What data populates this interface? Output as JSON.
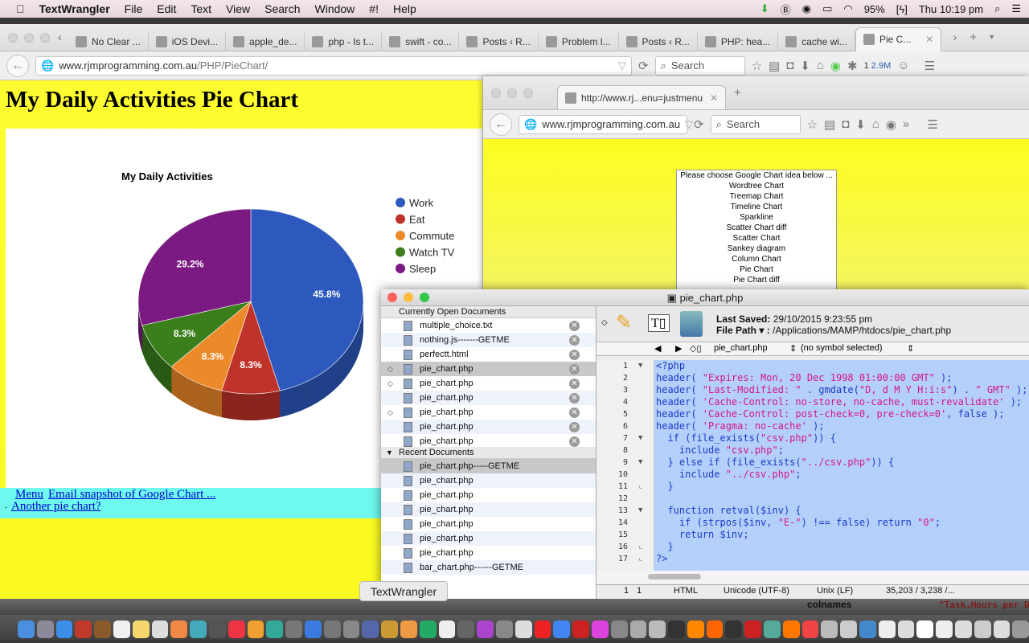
{
  "menubar": {
    "app": "TextWrangler",
    "items": [
      "File",
      "Edit",
      "Text",
      "View",
      "Search",
      "Window",
      "#!",
      "Help"
    ],
    "battery": "95%",
    "clock": "Thu 10:19 pm"
  },
  "browser1": {
    "tabs": [
      {
        "label": "No Clear ..."
      },
      {
        "label": "iOS Devi..."
      },
      {
        "label": "apple_de..."
      },
      {
        "label": "php - Is t..."
      },
      {
        "label": "swift - co..."
      },
      {
        "label": "Posts ‹ R..."
      },
      {
        "label": "Problem l..."
      },
      {
        "label": "Posts ‹ R..."
      },
      {
        "label": "PHP: hea..."
      },
      {
        "label": "cache wi..."
      },
      {
        "label": "Pie C...",
        "active": true
      }
    ],
    "url_host": "www.rjmprogramming.com.au",
    "url_path": "/PHP/PieChart/",
    "search_placeholder": "Search",
    "badge": "1",
    "badge2": "2.9M",
    "page": {
      "title": "My Daily Activities Pie Chart",
      "links": {
        "menu": "Menu",
        "email": "Email snapshot of Google Chart ...",
        "bullet": ".",
        "another": "Another pie chart?"
      }
    }
  },
  "chart_data": {
    "type": "pie",
    "title": "My Daily Activities",
    "legend": "right",
    "style": "3d",
    "categories": [
      "Work",
      "Eat",
      "Commute",
      "Watch TV",
      "Sleep"
    ],
    "values": [
      11,
      2,
      2,
      2,
      7
    ],
    "labels": [
      "45.8%",
      "8.3%",
      "8.3%",
      "8.3%",
      "29.2%"
    ],
    "colors": [
      "#2d59be",
      "#c0332a",
      "#ec8a2a",
      "#3b7f1d",
      "#7b1a82"
    ]
  },
  "browser2": {
    "tab": "http://www.rj...enu=justmenu",
    "url": "www.rjmprogramming.com.au",
    "search_placeholder": "Search",
    "select_options": [
      "Please choose Google Chart idea below ...",
      "Wordtree Chart",
      "Treemap Chart",
      "Timeline Chart",
      "Sparkline",
      "Scatter Chart diff",
      "Scatter Chart",
      "Sankey diagram",
      "Column Chart",
      "Pie Chart",
      "Pie Chart diff"
    ]
  },
  "textwrangler": {
    "title": "pie_chart.php",
    "open_header": "Currently Open Documents",
    "open_docs": [
      {
        "name": "multiple_choice.txt"
      },
      {
        "name": "nothing.js-------GETME"
      },
      {
        "name": "perfectt.html"
      },
      {
        "name": "pie_chart.php",
        "sel": true,
        "mod": true
      },
      {
        "name": "pie_chart.php",
        "mod": true
      },
      {
        "name": "pie_chart.php"
      },
      {
        "name": "pie_chart.php",
        "mod": true
      },
      {
        "name": "pie_chart.php"
      },
      {
        "name": "pie_chart.php"
      }
    ],
    "recent_header": "Recent Documents",
    "recent_docs": [
      {
        "name": "pie_chart.php-----GETME",
        "sel": true
      },
      {
        "name": "pie_chart.php"
      },
      {
        "name": "pie_chart.php"
      },
      {
        "name": "pie_chart.php"
      },
      {
        "name": "pie_chart.php"
      },
      {
        "name": "pie_chart.php"
      },
      {
        "name": "pie_chart.php"
      },
      {
        "name": "bar_chart.php------GETME"
      }
    ],
    "last_saved_label": "Last Saved:",
    "last_saved": "29/10/2015 9:23:55 pm",
    "file_path_label": "File Path ▾ :",
    "file_path": "/Applications/MAMP/htdocs/pie_chart.php",
    "nav_file": "pie_chart.php",
    "nav_symbol": "(no symbol selected)",
    "code": [
      "<?php",
      "header( \"Expires: Mon, 20 Dec 1998 01:00:00 GMT\" );",
      "header( \"Last-Modified: \" . gmdate(\"D, d M Y H:i:s\") . \" GMT\" );",
      "header( 'Cache-Control: no-store, no-cache, must-revalidate' );",
      "header( 'Cache-Control: post-check=0, pre-check=0', false );",
      "header( 'Pragma: no-cache' );",
      "  if (file_exists(\"csv.php\")) {",
      "    include \"csv.php\";",
      "  } else if (file_exists(\"../csv.php\")) {",
      "    include \"../csv.php\";",
      "  }",
      "",
      "  function retval($inv) {",
      "    if (strpos($inv, \"E-\") !== false) return \"0\";",
      "    return $inv;",
      "  }",
      "?>"
    ],
    "folds": {
      "1": "▼",
      "7": "▼",
      "9": "▼",
      "11": "⌞",
      "13": "▼",
      "16": "⌞",
      "17": "⌞"
    },
    "status": {
      "line": "1",
      "col": "1",
      "lang": "HTML",
      "encoding": "Unicode (UTF-8)",
      "lineend": "Unix (LF)",
      "size": "35,203 / 3,238 /..."
    }
  },
  "tooltip": "TextWrangler",
  "behind": {
    "label": "colnames",
    "value": "\"Task,Hours per D"
  },
  "dock_colors": [
    "#4a8fe0",
    "#8a8a9a",
    "#3d8ee8",
    "#c0392b",
    "#8b5a2b",
    "#f0f0f0",
    "#f5d76e",
    "#ddd",
    "#e84",
    "#4ab",
    "#555",
    "#e34",
    "#f0a030",
    "#3a9",
    "#777",
    "#3b7be0",
    "#777",
    "#888",
    "#56a",
    "#c93",
    "#e94",
    "#2a6",
    "#eee",
    "#666",
    "#a4c",
    "#888",
    "#ddd",
    "#e22",
    "#4285f4",
    "#c22",
    "#d4d",
    "#888",
    "#aaa",
    "#bbb",
    "#333",
    "#f80",
    "#f60",
    "#333",
    "#c22",
    "#5a9",
    "#f70",
    "#e44",
    "#bbb",
    "#ccc",
    "#48c",
    "#eee",
    "#ddd",
    "#fff",
    "#eee",
    "#ddd",
    "#ccc",
    "#ddd",
    "#999"
  ]
}
